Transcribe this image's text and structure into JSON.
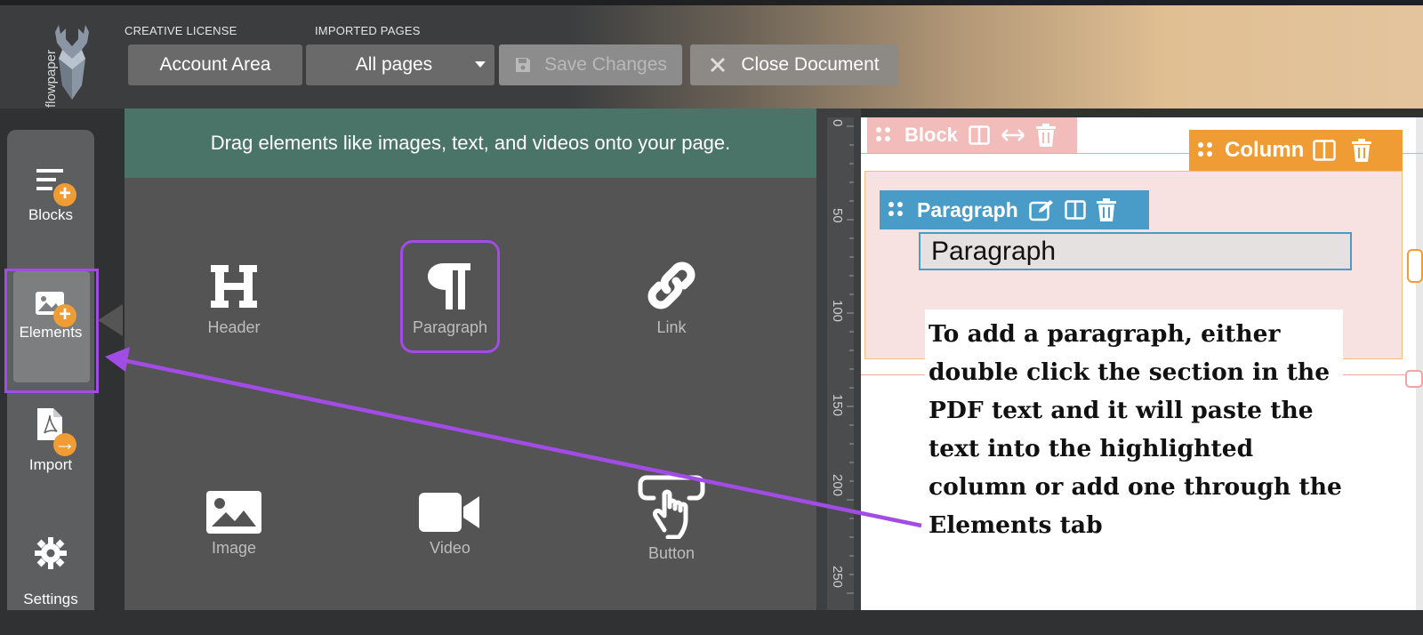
{
  "app": {
    "logo_text": "flowpaper"
  },
  "toolbar": {
    "license_label": "CREATIVE LICENSE",
    "imported_label": "IMPORTED PAGES",
    "account_button": "Account Area",
    "pages_select": "All pages",
    "save_button": "Save Changes",
    "close_button": "Close Document"
  },
  "sidebar": {
    "items": [
      {
        "label": "Blocks"
      },
      {
        "label": "Elements"
      },
      {
        "label": "Import"
      },
      {
        "label": "Settings"
      }
    ]
  },
  "panel": {
    "instruction": "Drag elements like images, text, and videos onto your page.",
    "elements": [
      {
        "label": "Header",
        "icon": "header-icon"
      },
      {
        "label": "Paragraph",
        "icon": "pilcrow-icon"
      },
      {
        "label": "Link",
        "icon": "link-icon"
      },
      {
        "label": "Image",
        "icon": "image-icon"
      },
      {
        "label": "Video",
        "icon": "video-icon"
      },
      {
        "label": "Button",
        "icon": "pointer-hand-icon"
      }
    ]
  },
  "ruler": {
    "ticks": [
      "0",
      "50",
      "100",
      "150",
      "200",
      "250"
    ]
  },
  "canvas": {
    "block_tag": "Block",
    "column_tag": "Column",
    "paragraph_tag": "Paragraph",
    "paragraph_text": "Paragraph",
    "annotation": "To add a paragraph, either double click the section in the PDF text and it will paste the text into the highlighted column or add one through the Elements tab"
  },
  "colors": {
    "accent_purple": "#a24ce6",
    "orange": "#ef9c34",
    "blue": "#4a9cc8",
    "block_pink": "#f2bcba",
    "panel_green": "#4b7468"
  }
}
